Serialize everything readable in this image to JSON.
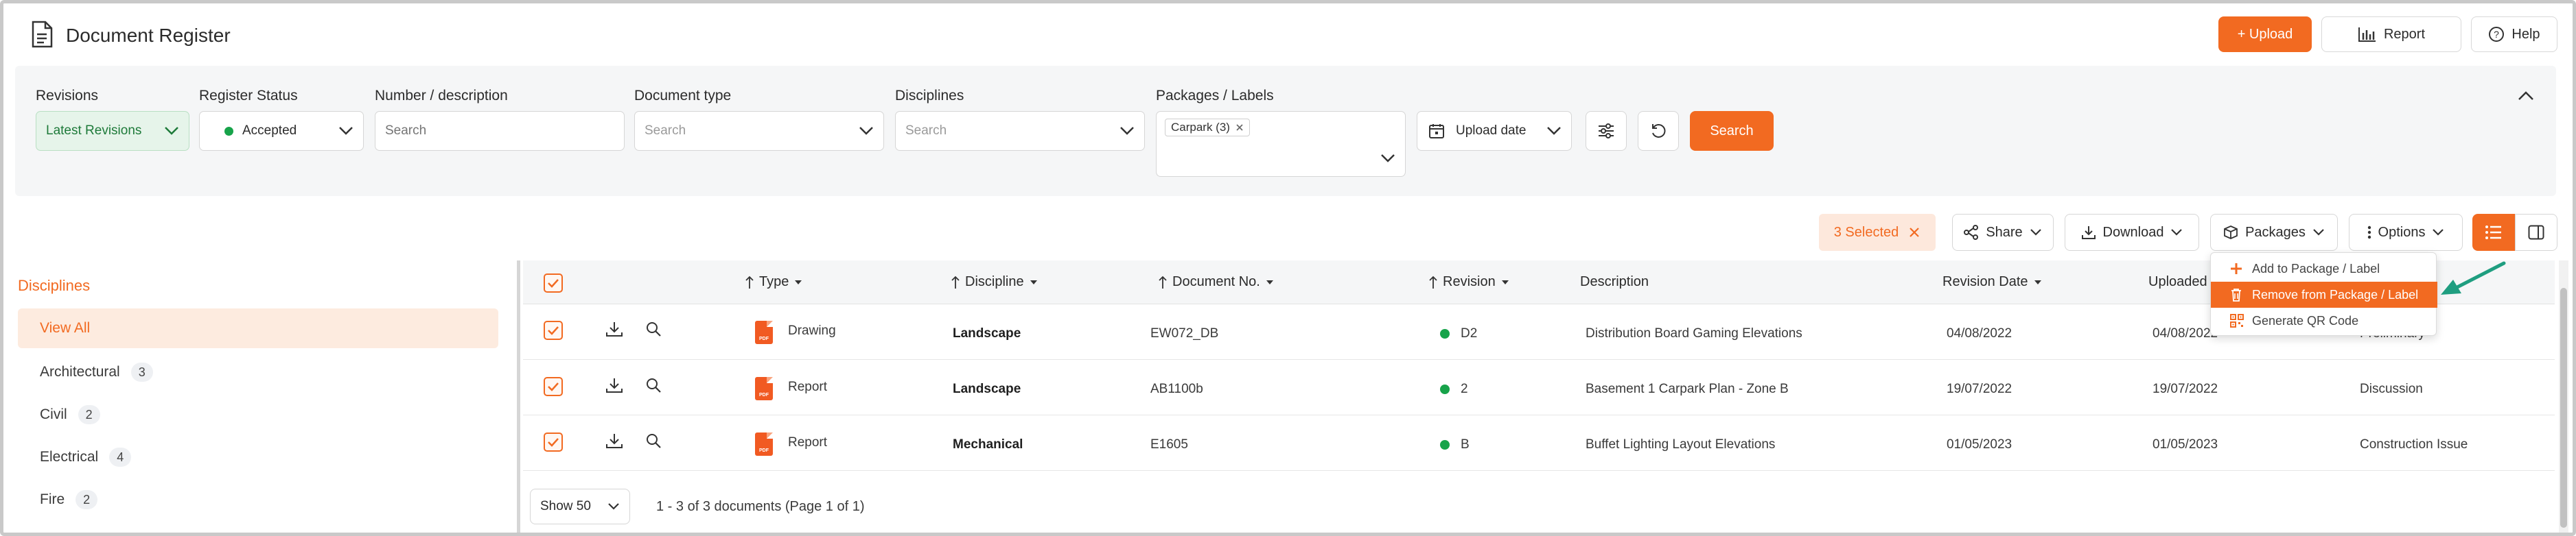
{
  "header": {
    "title": "Document Register",
    "upload_label": "+ Upload",
    "report_label": "Report",
    "help_label": "Help"
  },
  "filters": {
    "revisions_label": "Revisions",
    "revisions_value": "Latest Revisions",
    "register_status_label": "Register Status",
    "register_status_value": "Accepted",
    "number_label": "Number / description",
    "number_placeholder": "Search",
    "doctype_label": "Document type",
    "doctype_placeholder": "Search",
    "disciplines_label": "Disciplines",
    "disciplines_placeholder": "Search",
    "packages_label": "Packages / Labels",
    "packages_tag": "Carpark (3)",
    "upload_date_label": "Upload date",
    "search_label": "Search"
  },
  "toolbar": {
    "selected_label": "3 Selected",
    "share_label": "Share",
    "download_label": "Download",
    "packages_label": "Packages",
    "options_label": "Options"
  },
  "packages_menu": {
    "items": [
      "Add to Package / Label",
      "Remove from Package / Label",
      "Generate QR Code"
    ]
  },
  "sidebar": {
    "title": "Disciplines",
    "items": [
      {
        "label": "View All",
        "count": ""
      },
      {
        "label": "Architectural",
        "count": "3"
      },
      {
        "label": "Civil",
        "count": "2"
      },
      {
        "label": "Electrical",
        "count": "4"
      },
      {
        "label": "Fire",
        "count": "2"
      }
    ]
  },
  "table": {
    "columns": {
      "type": "Type",
      "discipline": "Discipline",
      "docno": "Document No.",
      "revision": "Revision",
      "description": "Description",
      "revdate": "Revision Date",
      "uploaded": "Uploaded"
    },
    "rows": [
      {
        "type": "Drawing",
        "discipline": "Landscape",
        "docno": "EW072_DB",
        "revision": "D2",
        "description": "Distribution Board Gaming Elevations",
        "revdate": "04/08/2022",
        "uploaded": "04/08/2022",
        "status": "Preliminary"
      },
      {
        "type": "Report",
        "discipline": "Landscape",
        "docno": "AB1100b",
        "revision": "2",
        "description": "Basement 1 Carpark Plan - Zone B",
        "revdate": "19/07/2022",
        "uploaded": "19/07/2022",
        "status": "Discussion"
      },
      {
        "type": "Report",
        "discipline": "Mechanical",
        "docno": "E1605",
        "revision": "B",
        "description": "Buffet Lighting Layout Elevations",
        "revdate": "01/05/2023",
        "uploaded": "01/05/2023",
        "status": "Construction Issue"
      }
    ],
    "pdf_label": "PDF"
  },
  "footer": {
    "show_label": "Show 50",
    "info": "1 - 3 of 3 documents (Page 1 of 1)"
  },
  "colors": {
    "accent": "#f26a21",
    "status_green": "#17a34a",
    "arrow_teal": "#1f9e80"
  }
}
